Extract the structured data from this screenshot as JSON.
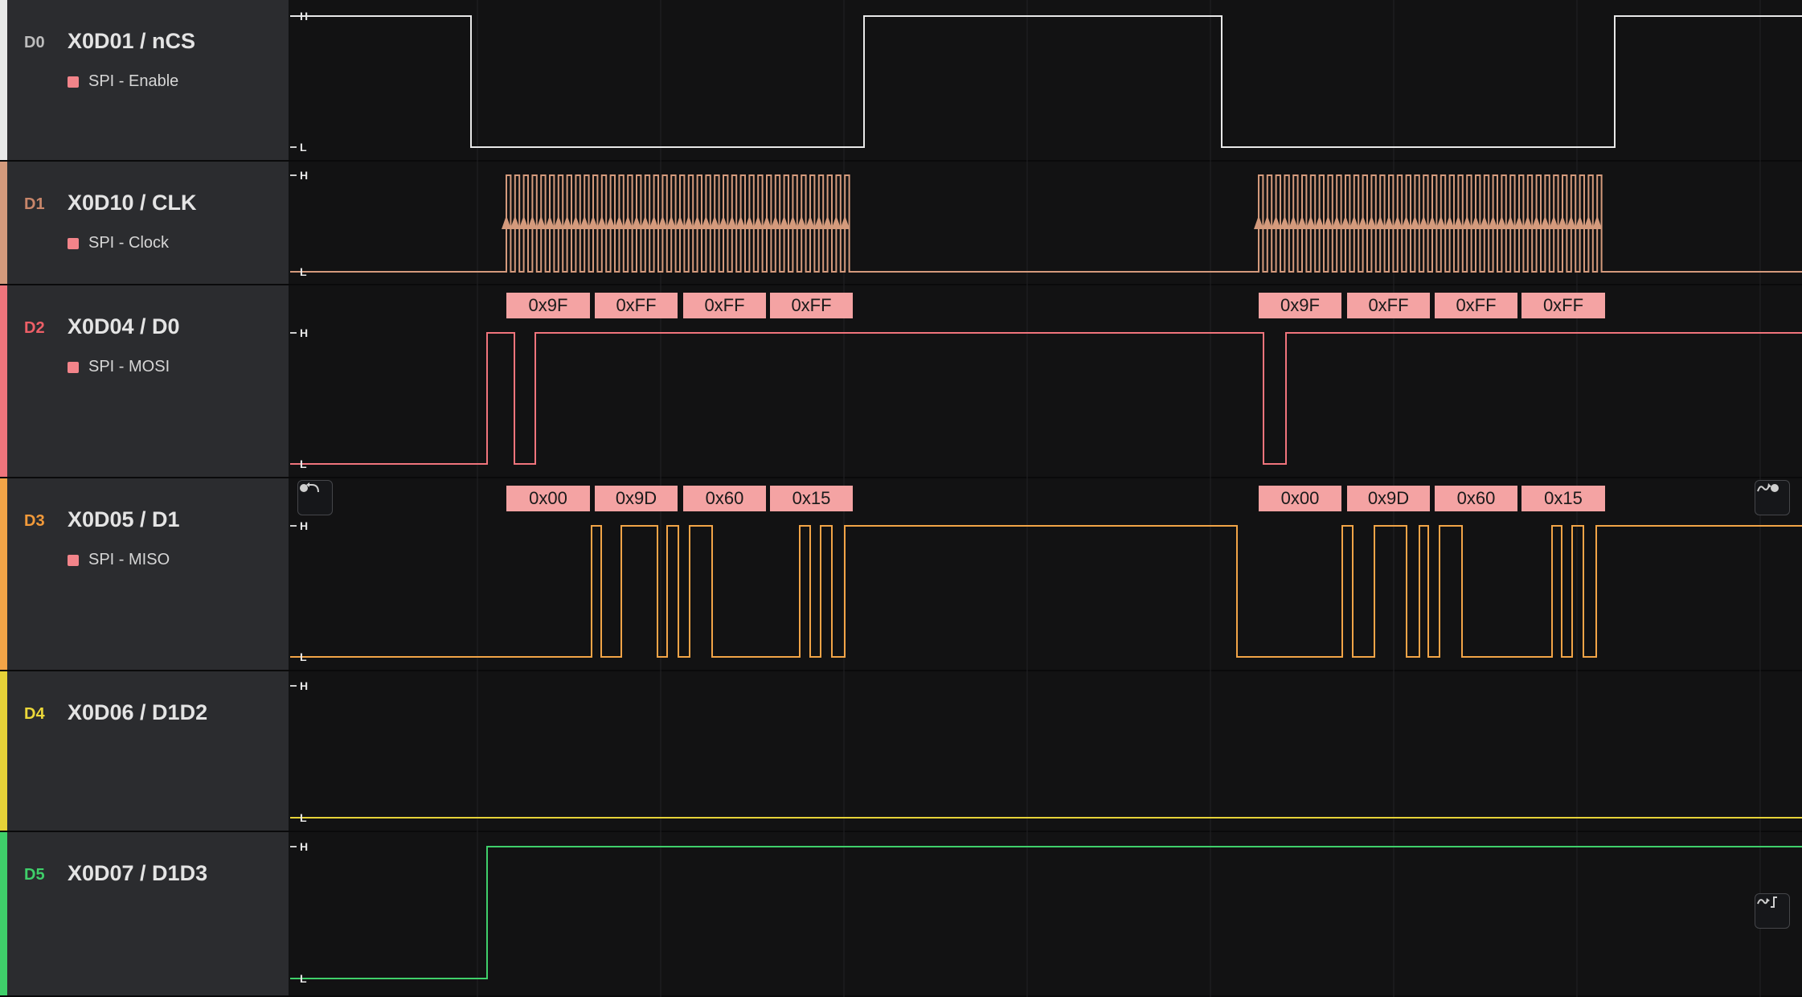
{
  "channels": [
    {
      "id": "D0",
      "name": "X0D01 / nCS",
      "analyzer": "SPI - Enable",
      "color": "#e8e8e8",
      "id_color": "#bdbdbd",
      "high": "H",
      "low": "L"
    },
    {
      "id": "D1",
      "name": "X0D10 / CLK",
      "analyzer": "SPI - Clock",
      "color": "#d49a7c",
      "id_color": "#c8866a",
      "high": "H",
      "low": "L"
    },
    {
      "id": "D2",
      "name": "X0D04 / D0",
      "analyzer": "SPI - MOSI",
      "color": "#f0747c",
      "id_color": "#ee5f67",
      "high": "H",
      "low": "L"
    },
    {
      "id": "D3",
      "name": "X0D05 / D1",
      "analyzer": "SPI - MISO",
      "color": "#f2a447",
      "id_color": "#f29a3a",
      "high": "H",
      "low": "L"
    },
    {
      "id": "D4",
      "name": "X0D06 / D1D2",
      "analyzer": "",
      "color": "#e6d238",
      "id_color": "#ecd83a",
      "high": "H",
      "low": "L"
    },
    {
      "id": "D5",
      "name": "X0D07 / D1D3",
      "analyzer": "",
      "color": "#3fcf6a",
      "id_color": "#3fcf6a",
      "high": "H",
      "low": "L"
    }
  ],
  "decoded": {
    "mosi": [
      "0x9F",
      "0xFF",
      "0xFF",
      "0xFF",
      "0x9F",
      "0xFF",
      "0xFF",
      "0xFF"
    ],
    "miso": [
      "0x00",
      "0x9D",
      "0x60",
      "0x15",
      "0x00",
      "0x9D",
      "0x60",
      "0x15"
    ]
  },
  "decode_color": "#f4a3a3",
  "controls": {
    "prev_edge_icon": "jump-previous-edge-icon",
    "next_edge_icon": "jump-next-edge-icon",
    "next_transition_icon": "next-transition-icon"
  }
}
